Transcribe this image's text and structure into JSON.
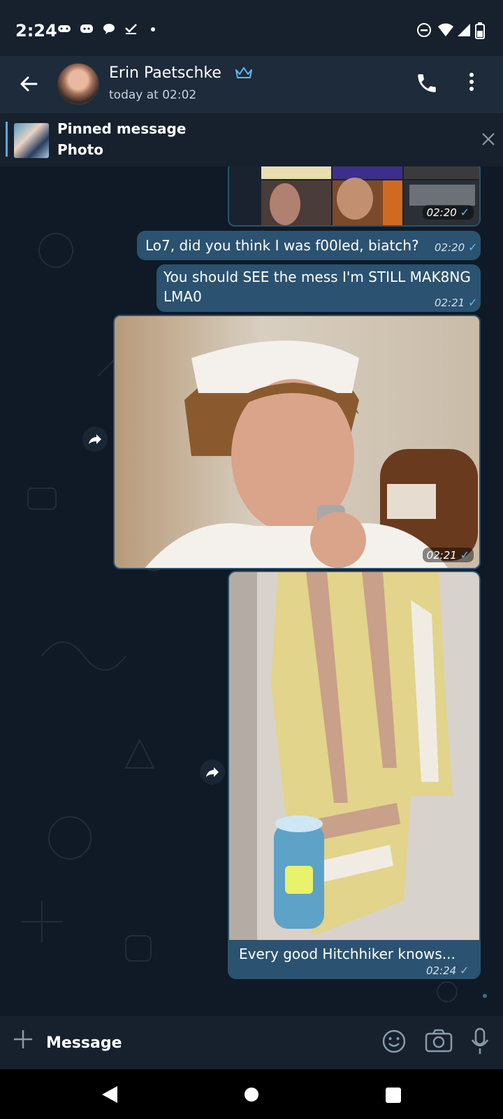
{
  "status_bar": {
    "time": "2:24",
    "left_icons": [
      "game-controller-icon",
      "discord-icon",
      "chat-bubble-icon",
      "checkmark-icon",
      "dot-icon"
    ],
    "right_icons": [
      "do-not-disturb-icon",
      "wifi-icon",
      "signal-icon",
      "battery-icon"
    ]
  },
  "header": {
    "contact_name": "Erin Paetschke",
    "last_seen": "today at 02:02",
    "premium_icon": "crown-icon"
  },
  "pinned": {
    "title": "Pinned message",
    "subtitle": "Photo"
  },
  "messages": [
    {
      "type": "photo",
      "time": "02:20",
      "status": "sent"
    },
    {
      "type": "text",
      "text": "Lo7, did you think I was f00led, biatch?",
      "time": "02:20",
      "status": "sent"
    },
    {
      "type": "text",
      "text": "You should SEE the mess I'm STILL MAK8NG LMA0",
      "time": "02:21",
      "status": "sent"
    },
    {
      "type": "photo",
      "time": "02:21",
      "status": "sent"
    },
    {
      "type": "photo",
      "caption": "Every good Hitchhiker knows...",
      "time": "02:24",
      "status": "sent"
    }
  ],
  "composer": {
    "placeholder": "Message"
  },
  "colors": {
    "background": "#0f1a26",
    "header": "#1d2b3a",
    "outgoing_bubble": "#2b5270",
    "accent": "#62b8f0"
  }
}
